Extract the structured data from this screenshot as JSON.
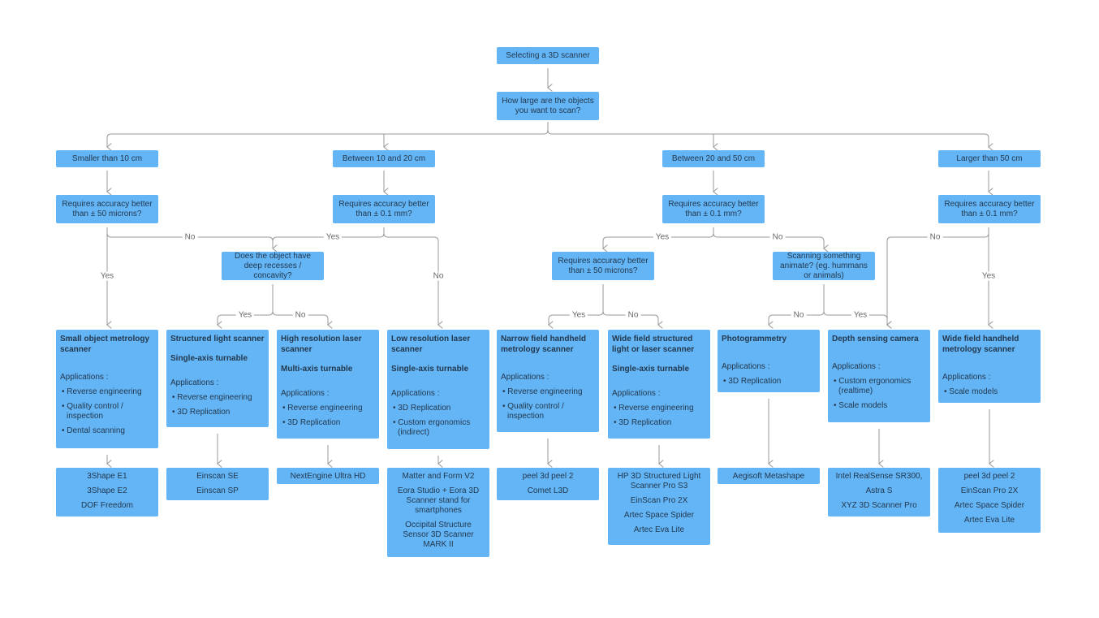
{
  "title": "Selecting a 3D scanner",
  "question": "How large are the objects you want to scan?",
  "sizes": [
    "Smaller than 10 cm",
    "Between 10 and 20 cm",
    "Between 20 and 50 cm",
    "Larger than 50 cm"
  ],
  "accuracy_questions": [
    "Requires accuracy better than ± 50 microns?",
    "Requires accuracy better than ± 0.1 mm?",
    "Requires accuracy better than ± 0.1 mm?",
    "Requires accuracy better than ± 0.1 mm?"
  ],
  "sub_questions": [
    "Does the object have deep recesses / concavity?",
    "Requires accuracy better than ± 50 microns?",
    "Scanning something animate? (eg. hummans or animals)"
  ],
  "edge_labels": [
    "No",
    "Yes",
    "Yes",
    "No",
    "Yes",
    "No",
    "Yes",
    "No",
    "Yes",
    "No",
    "No",
    "Yes",
    "No",
    "Yes"
  ],
  "scanners": [
    {
      "name": "Small object metrology scanner",
      "subtitle": "",
      "applications_label": "Applications :",
      "applications": [
        "Reverse engineering",
        "Quality control / inspection",
        "Dental scanning"
      ]
    },
    {
      "name": "Structured light scanner",
      "subtitle": "Single-axis turnable",
      "applications_label": "Applications :",
      "applications": [
        "Reverse engineering",
        "3D Replication"
      ]
    },
    {
      "name": "High resolution laser scanner",
      "subtitle": "Multi-axis turnable",
      "applications_label": "Applications :",
      "applications": [
        "Reverse engineering",
        "3D Replication"
      ]
    },
    {
      "name": "Low resolution laser scanner",
      "subtitle": "Single-axis turnable",
      "applications_label": "Applications :",
      "applications": [
        "3D Replication",
        "Custom ergonomics (indirect)"
      ]
    },
    {
      "name": "Narrow field handheld metrology scanner",
      "subtitle": "",
      "applications_label": "Applications :",
      "applications": [
        "Reverse engineering",
        "Quality control / inspection"
      ]
    },
    {
      "name": "Wide field structured light or laser scanner",
      "subtitle": "Single-axis turnable",
      "applications_label": "Applications :",
      "applications": [
        "Reverse engineering",
        "3D Replication"
      ]
    },
    {
      "name": "Photogrammetry",
      "subtitle": "",
      "applications_label": "Applications :",
      "applications": [
        "3D Replication"
      ]
    },
    {
      "name": "Depth sensing camera",
      "subtitle": "",
      "applications_label": "Applications :",
      "applications": [
        "Custom ergonomics (realtime)",
        "Scale models"
      ]
    },
    {
      "name": "Wide field handheld metrology scanner",
      "subtitle": "",
      "applications_label": "Applications :",
      "applications": [
        "Scale models"
      ]
    }
  ],
  "products": [
    [
      "3Shape E1",
      "3Shape E2",
      "DOF Freedom"
    ],
    [
      "Einscan SE",
      "Einscan SP"
    ],
    [
      "NextEngine Ultra HD"
    ],
    [
      "Matter and Form V2",
      "Eora Studio + Eora 3D Scanner stand for smartphones",
      "Occipital Structure Sensor 3D Scanner MARK II"
    ],
    [
      "peel 3d peel 2",
      "Comet L3D"
    ],
    [
      "HP 3D Structured Light Scanner Pro S3",
      "EinScan Pro 2X",
      "Artec Space Spider",
      "Artec Eva Lite"
    ],
    [
      "Aegisoft Metashape"
    ],
    [
      "Intel RealSense SR300,",
      "Astra S",
      "XYZ 3D Scanner Pro"
    ],
    [
      "peel 3d peel 2",
      "EinScan Pro 2X",
      "Artec Space Spider",
      "Artec Eva Lite"
    ]
  ],
  "colors": {
    "box": "#64b5f6",
    "text": "#23384d",
    "line": "#9a9a9a"
  }
}
